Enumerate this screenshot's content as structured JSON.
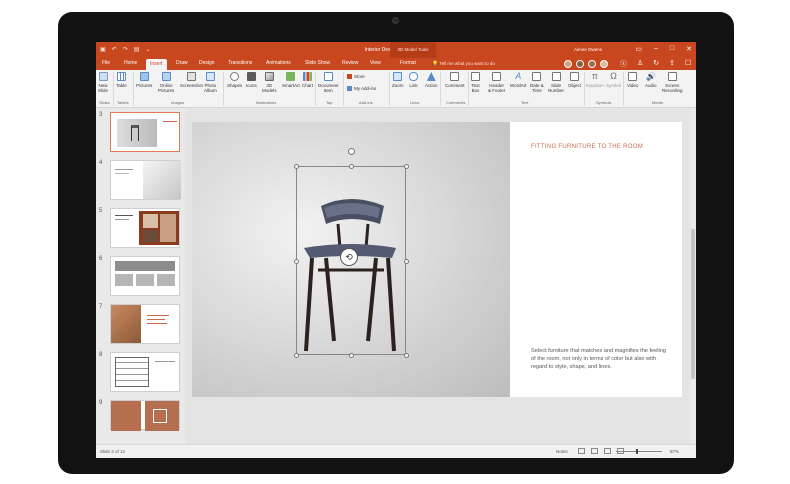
{
  "app": {
    "title": "Interior Design  -  PowerPoint",
    "contextual_tab": "3D Model Tools",
    "user": "Aimee Owens"
  },
  "tabs": [
    "File",
    "Home",
    "Insert",
    "Draw",
    "Design",
    "Transitions",
    "Animations",
    "Slide Show",
    "Review",
    "View",
    "Format"
  ],
  "active_tab": "Insert",
  "tell_me": "Tell me what you want to do",
  "ribbon": {
    "buttons": [
      {
        "label": "New\nSlide",
        "icon": "new-slide-icon"
      },
      {
        "label": "Table",
        "icon": "table-icon"
      },
      {
        "label": "Pictures",
        "icon": "pictures-icon"
      },
      {
        "label": "Online\nPictures",
        "icon": "online-pictures-icon"
      },
      {
        "label": "Screenshot",
        "icon": "screenshot-icon"
      },
      {
        "label": "Photo\nAlbum",
        "icon": "photo-album-icon"
      },
      {
        "label": "Shapes",
        "icon": "shapes-icon"
      },
      {
        "label": "Icons",
        "icon": "icons-icon"
      },
      {
        "label": "3D\nModels",
        "icon": "3d-models-icon"
      },
      {
        "label": "SmartArt",
        "icon": "smartart-icon"
      },
      {
        "label": "Chart",
        "icon": "chart-icon"
      },
      {
        "label": "Document\nItem",
        "icon": "document-item-icon"
      },
      {
        "label": "Zoom",
        "icon": "zoom-icon"
      },
      {
        "label": "Link",
        "icon": "link-icon"
      },
      {
        "label": "Action",
        "icon": "action-icon"
      },
      {
        "label": "Comment",
        "icon": "comment-icon"
      },
      {
        "label": "Text\nBox",
        "icon": "text-box-icon"
      },
      {
        "label": "Header\n& Footer",
        "icon": "header-footer-icon"
      },
      {
        "label": "WordArt",
        "icon": "wordart-icon"
      },
      {
        "label": "Date &\nTime",
        "icon": "date-time-icon"
      },
      {
        "label": "Slide\nNumber",
        "icon": "slide-number-icon"
      },
      {
        "label": "Object",
        "icon": "object-icon"
      },
      {
        "label": "Equation",
        "icon": "equation-icon"
      },
      {
        "label": "Symbol",
        "icon": "symbol-icon"
      },
      {
        "label": "Video",
        "icon": "video-icon"
      },
      {
        "label": "Audio",
        "icon": "audio-icon"
      },
      {
        "label": "Screen\nRecording",
        "icon": "screen-recording-icon"
      }
    ],
    "store": "Store",
    "my_addins": "My Add-ins",
    "groups": [
      "Slides",
      "Tables",
      "Images",
      "Illustrations",
      "Tap",
      "Add-ins",
      "Links",
      "Comments",
      "Text",
      "Symbols",
      "Media"
    ]
  },
  "thumbnails": [
    {
      "number": "3"
    },
    {
      "number": "4"
    },
    {
      "number": "5"
    },
    {
      "number": "6"
    },
    {
      "number": "7"
    },
    {
      "number": "8"
    },
    {
      "number": "9"
    }
  ],
  "slide": {
    "title": "FITTING FURNITURE TO THE ROOM",
    "body": "Select furniture that matches and magnifies the feeling of the room, not only in terms of color but also with regard to style, shape, and lines."
  },
  "status": {
    "slide_info": "Slide 3 of 12",
    "notes": "Notes",
    "zoom": "87%"
  },
  "colors": {
    "accent": "#c9471f",
    "title_text": "#c9694a"
  }
}
